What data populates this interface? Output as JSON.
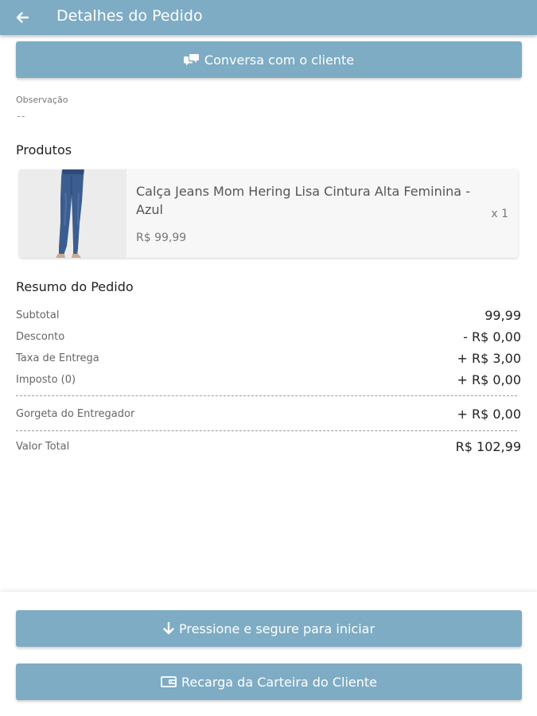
{
  "appbar": {
    "title": "Detalhes do Pedido"
  },
  "chat_button": {
    "label": "Conversa com o cliente"
  },
  "observation": {
    "label": "Observação",
    "value": "--"
  },
  "products": {
    "title": "Produtos",
    "items": [
      {
        "name": "Calça Jeans Mom Hering Lisa Cintura Alta Feminina - Azul",
        "price": "R$ 99,99",
        "quantity": "x 1"
      }
    ]
  },
  "summary": {
    "title": "Resumo do Pedido",
    "subtotal": {
      "label": "Subtotal",
      "value": "99,99"
    },
    "discount": {
      "label": "Desconto",
      "value": "- R$ 0,00"
    },
    "delivery_fee": {
      "label": "Taxa de Entrega",
      "value": "+ R$ 3,00"
    },
    "tax": {
      "label": "Imposto (0)",
      "value": "+ R$ 0,00"
    },
    "tip": {
      "label": "Gorgeta do Entregador",
      "value": "+ R$ 0,00"
    },
    "total": {
      "label": "Valor Total",
      "value": "R$ 102,99"
    }
  },
  "actions": {
    "start_label": "Pressione e segure para iniciar",
    "wallet_label": "Recarga da Carteira do Cliente"
  },
  "icons": {
    "back": "arrow-left-icon",
    "chat": "chat-bubbles-icon",
    "start": "arrow-down-icon",
    "wallet": "wallet-icon"
  },
  "colors": {
    "primary": "#7eacc4",
    "on_primary": "#ffffff",
    "card_background": "#f7f7f7"
  }
}
